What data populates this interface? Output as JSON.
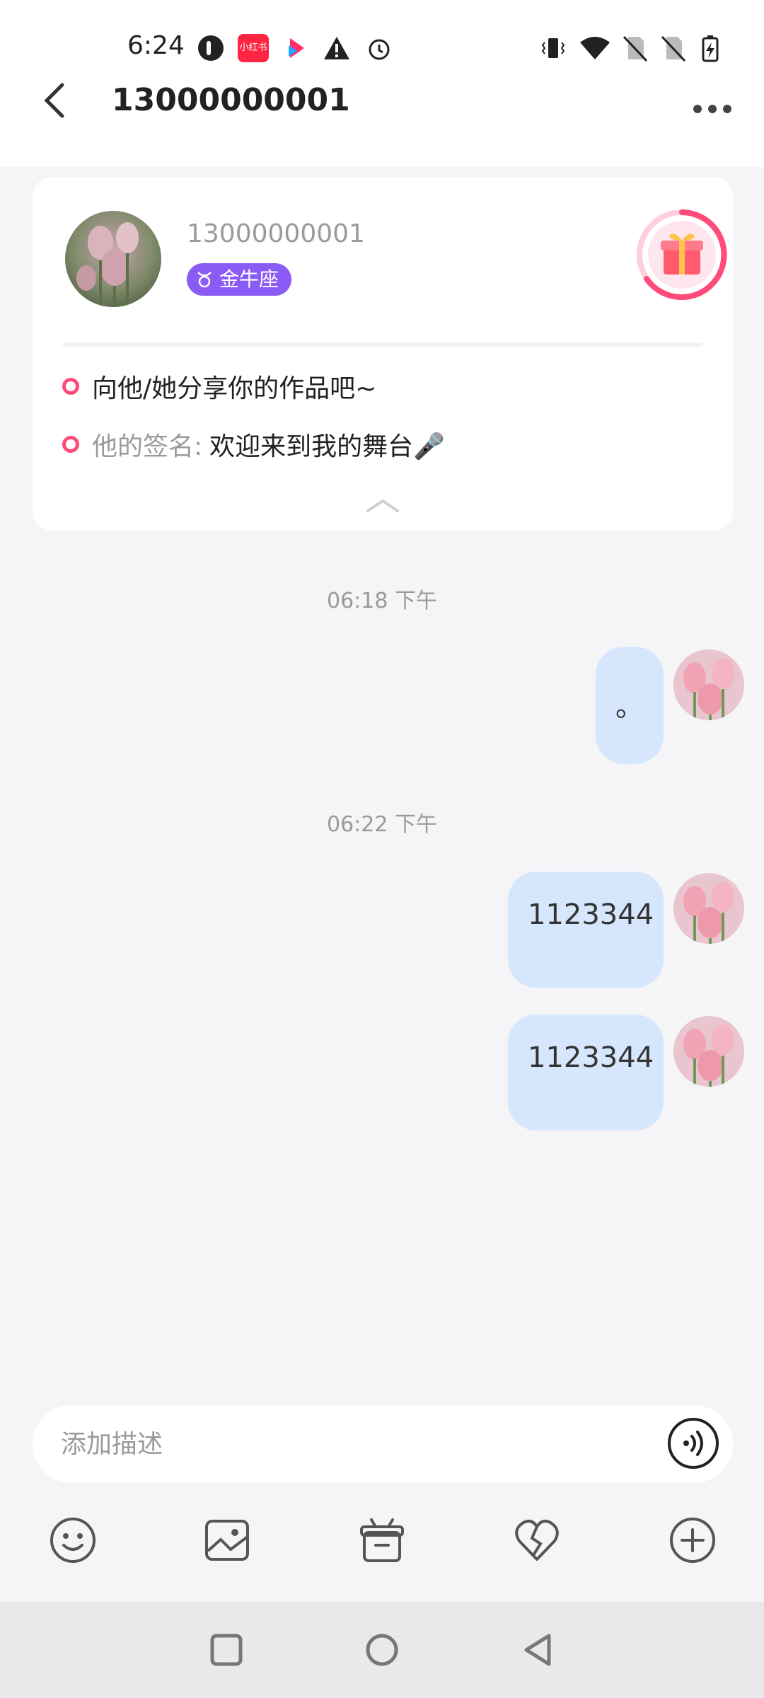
{
  "status_bar": {
    "time": "6:24",
    "app_badge_text": "小红书"
  },
  "header": {
    "title": "13000000001"
  },
  "profile": {
    "name": "13000000001",
    "zodiac": "金牛座",
    "share_prompt": "向他/她分享你的作品吧~",
    "signature_label": "他的签名:",
    "signature_text": "欢迎来到我的舞台🎤"
  },
  "messages": [
    {
      "timestamp": "06:18 下午",
      "text": "。"
    },
    {
      "timestamp": "06:22 下午",
      "text": "1123344"
    },
    {
      "timestamp": "",
      "text": "1123344"
    }
  ],
  "input": {
    "placeholder": "添加描述"
  },
  "colors": {
    "accent_pink": "#ff4b7a",
    "zodiac_purple": "#8a5cf5",
    "bubble_blue": "#d6e6fc"
  }
}
